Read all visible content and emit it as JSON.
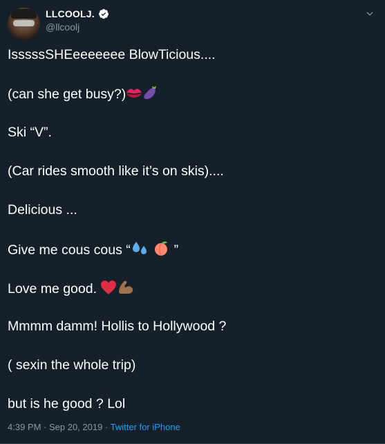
{
  "tweet": {
    "display_name": "LLCOOLJ.",
    "handle": "@llcoolj",
    "lines": [
      "IsssssSHEeeeeeee BlowTicious....",
      "(can she get busy?)",
      "Ski “V”.",
      "(Car rides smooth like it’s on skis)....",
      "Delicious ...",
      "Give me cous cous  “",
      "”",
      "Love me good.",
      "Mmmm damm! Hollis to Hollywood ?",
      "( sexin the whole trip)",
      "but is he good ? Lol"
    ],
    "emojis": [
      "kiss-mark",
      "eggplant",
      "sweat-droplets",
      "peach",
      "red-heart",
      "flexed-biceps"
    ],
    "timestamp": "4:39 PM · Sep 20, 2019",
    "separator": " · ",
    "source": "Twitter for iPhone"
  },
  "colors": {
    "background": "#15202b",
    "text": "#ffffff",
    "secondary": "#8899a6",
    "link": "#1da1f2",
    "verified": "#ffffff"
  }
}
